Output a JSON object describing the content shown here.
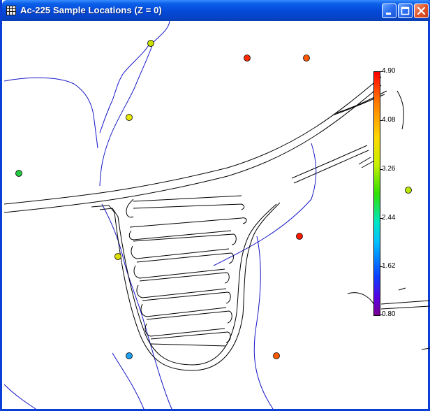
{
  "window": {
    "title": "Ac-225 Sample Locations (Z = 0)"
  },
  "titlebar_buttons": {
    "minimize": "minimize-icon",
    "maximize": "maximize-icon",
    "close": "close-icon"
  },
  "colorbar": {
    "ticks": [
      "4.90",
      "4.08",
      "3.26",
      "2.44",
      "1.62",
      "0.80"
    ],
    "min": 0.8,
    "max": 4.9,
    "colors": [
      "#7a0090",
      "#0a40ff",
      "#00bfff",
      "#2ee000",
      "#c8f000",
      "#ffd800",
      "#ff7700",
      "#ff0000"
    ]
  },
  "samples": [
    {
      "color": "#c8e000"
    },
    {
      "color": "#ff2a00"
    },
    {
      "color": "#ff5a00"
    },
    {
      "color": "#e8e800"
    },
    {
      "color": "#22c840"
    },
    {
      "color": "#b8e800"
    },
    {
      "color": "#ff1a00"
    },
    {
      "color": "#e0e000"
    },
    {
      "color": "#1ea0f0"
    },
    {
      "color": "#ff5a00"
    }
  ]
}
